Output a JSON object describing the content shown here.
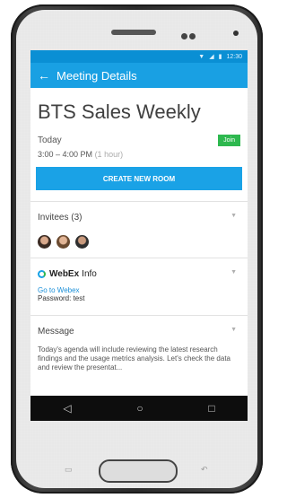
{
  "status_bar": {
    "time": "12:30"
  },
  "app_bar": {
    "title": "Meeting Details"
  },
  "meeting": {
    "title": "BTS Sales Weekly",
    "day": "Today",
    "time_range": "3:00 – 4:00 PM",
    "duration": "(1 hour)",
    "join_label": "Join",
    "create_room_label": "CREATE NEW ROOM"
  },
  "invitees": {
    "title": "Invitees (3)"
  },
  "webex": {
    "brand": "WebEx",
    "title_suffix": "Info",
    "link_label": "Go to Webex",
    "password_line": "Password: test"
  },
  "message": {
    "title": "Message",
    "body": "Today's agenda will include reviewing the latest research findings and the usage metrics analysis. Let's check the data and review the presentat..."
  }
}
